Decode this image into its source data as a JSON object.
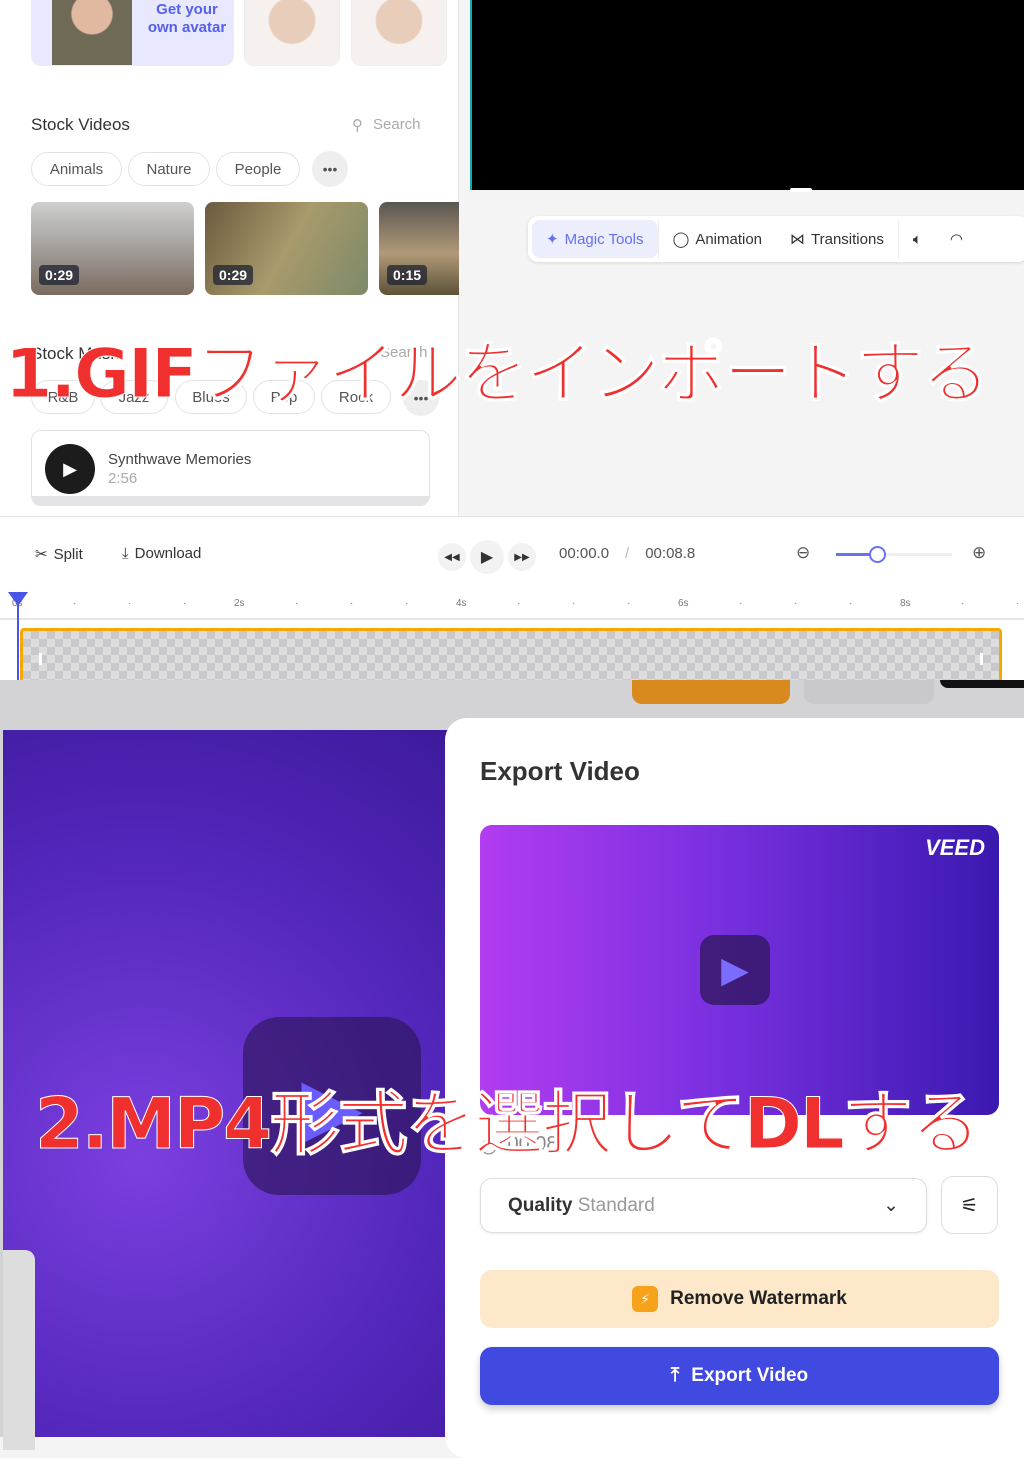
{
  "avatars": {
    "cta_line1": "Get your",
    "cta_line2": "own avatar"
  },
  "stock_videos": {
    "title": "Stock Videos",
    "search_placeholder": "Search",
    "filters": [
      "Animals",
      "Nature",
      "People"
    ],
    "more": "•••",
    "thumbs": [
      {
        "duration": "0:29"
      },
      {
        "duration": "0:29"
      },
      {
        "duration": "0:15"
      }
    ]
  },
  "stock_music": {
    "title": "Stock Music",
    "search_placeholder": "Search",
    "filters": [
      "R&B",
      "Jazz",
      "Blues",
      "Pop",
      "Rock"
    ],
    "more": "•••",
    "track": {
      "title": "Synthwave Memories",
      "duration": "2:56"
    }
  },
  "tool_tabs": [
    {
      "label": "Magic Tools",
      "icon": "sparkle-icon",
      "active": true
    },
    {
      "label": "Animation",
      "icon": "animation-icon"
    },
    {
      "label": "Transitions",
      "icon": "transitions-icon"
    }
  ],
  "timeline": {
    "split": "Split",
    "download": "Download",
    "current_time": "00:00.0",
    "separator": "/",
    "total_time": "00:08.8",
    "zoom_level": 0.35,
    "ticks": [
      "0s",
      "2s",
      "4s",
      "6s",
      "8s"
    ]
  },
  "overlay": {
    "step1": "1.GIFファイルをインポートする",
    "step2": "2.MP4形式を選択してDLする"
  },
  "export": {
    "title": "Export Video",
    "watermark": "VEED",
    "duration": "00:08",
    "quality_label": "Quality",
    "quality_value": "Standard",
    "remove_watermark": "Remove Watermark",
    "export_button": "Export Video"
  },
  "colors": {
    "accent": "#4049e0",
    "highlight": "#f5a800",
    "overlay_text": "#f0302e"
  }
}
